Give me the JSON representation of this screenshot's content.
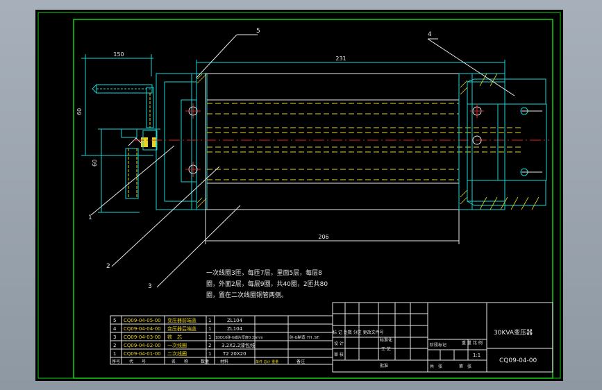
{
  "dimensions": {
    "top_width": "150",
    "overall_length": "231",
    "core_length": "206",
    "height_upper": "60",
    "height_lower": "60"
  },
  "callouts": [
    "1",
    "2",
    "3",
    "4",
    "5"
  ],
  "notes": {
    "line1": "一次线圈3匝，每匝7层，里面5层，每层8",
    "line2": "圈，外面2层，每层9圈，共40圈，2匝共80",
    "line3": "圈，置在二次线圈铜管两侧。"
  },
  "bom": {
    "rows": [
      {
        "no": "5",
        "code": "CQ09-04-05-00",
        "name": "变压器前端盖",
        "qty": "1",
        "material": "ZL104",
        "remark": ""
      },
      {
        "no": "4",
        "code": "CQ09-04-04-00",
        "name": "变压器后端盖",
        "qty": "1",
        "material": "ZL104",
        "remark": ""
      },
      {
        "no": "3",
        "code": "CQ09-04-03-00",
        "name": "铁　芯",
        "qty": "1",
        "material": "1DD10硅-G或片厚度0.35mm",
        "remark": "硅-G制造 7H .ST."
      },
      {
        "no": "2",
        "code": "CQ09-04-02-00",
        "name": "一次线圈",
        "qty": "2",
        "material": "3.2X2.2漆包线",
        "remark": ""
      },
      {
        "no": "1",
        "code": "CQ09-04-01-00",
        "name": "二次线圈",
        "qty": "1",
        "material": "T2 20X20",
        "remark": ""
      }
    ],
    "header": {
      "no": "序号",
      "code": "代　　号",
      "name": "名　　称",
      "qty": "数量",
      "material": "材料",
      "weight": "单件 总计 重量",
      "remark": "备注"
    }
  },
  "title_block": {
    "drawing_name": "30KVA变压器",
    "drawing_no": "CQ09-04-00",
    "rev_header": "标 记 处数 分区 更改文件号",
    "designer": "设 计",
    "standard": "标准化",
    "checker": "审 核",
    "process": "工 艺",
    "approve": "批准",
    "stage": "阶段标记",
    "weight": "重 量",
    "scale": "比 例",
    "scale_value": "1:1",
    "sheets_total": "共　张",
    "sheet_no": "第　张"
  }
}
